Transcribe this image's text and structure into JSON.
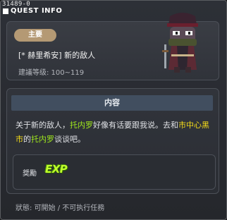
{
  "window": {
    "quest_id": "31489-0",
    "title": "QUEST INFO"
  },
  "quest": {
    "category_badge": "主要",
    "name": "[* 赫里希安] 新的敌人",
    "level": "建議等级: 100~119"
  },
  "content": {
    "header": "内容",
    "description_parts": [
      {
        "text": "关于新的敌人，",
        "style": "normal"
      },
      {
        "text": "托内罗",
        "style": "hl2"
      },
      {
        "text": "好像有话要跟我说。去和",
        "style": "normal"
      },
      {
        "text": "市中心黑市",
        "style": "hl"
      },
      {
        "text": "的",
        "style": "normal"
      },
      {
        "text": "托内罗",
        "style": "hl2"
      },
      {
        "text": "谈谈吧。",
        "style": "normal"
      }
    ],
    "reward_label": "奨勵",
    "reward_exp": "EXP"
  },
  "status": {
    "text": "狀態: 可開始 / 不可执行任務"
  },
  "colors": {
    "highlight_yellow": "#f7de18",
    "highlight_green": "#9ee61d",
    "badge": "#b49974",
    "exp": "#c0ff2c"
  },
  "icons": {
    "title": "quest-info-icon",
    "npc": "ninja-npc-portrait"
  }
}
